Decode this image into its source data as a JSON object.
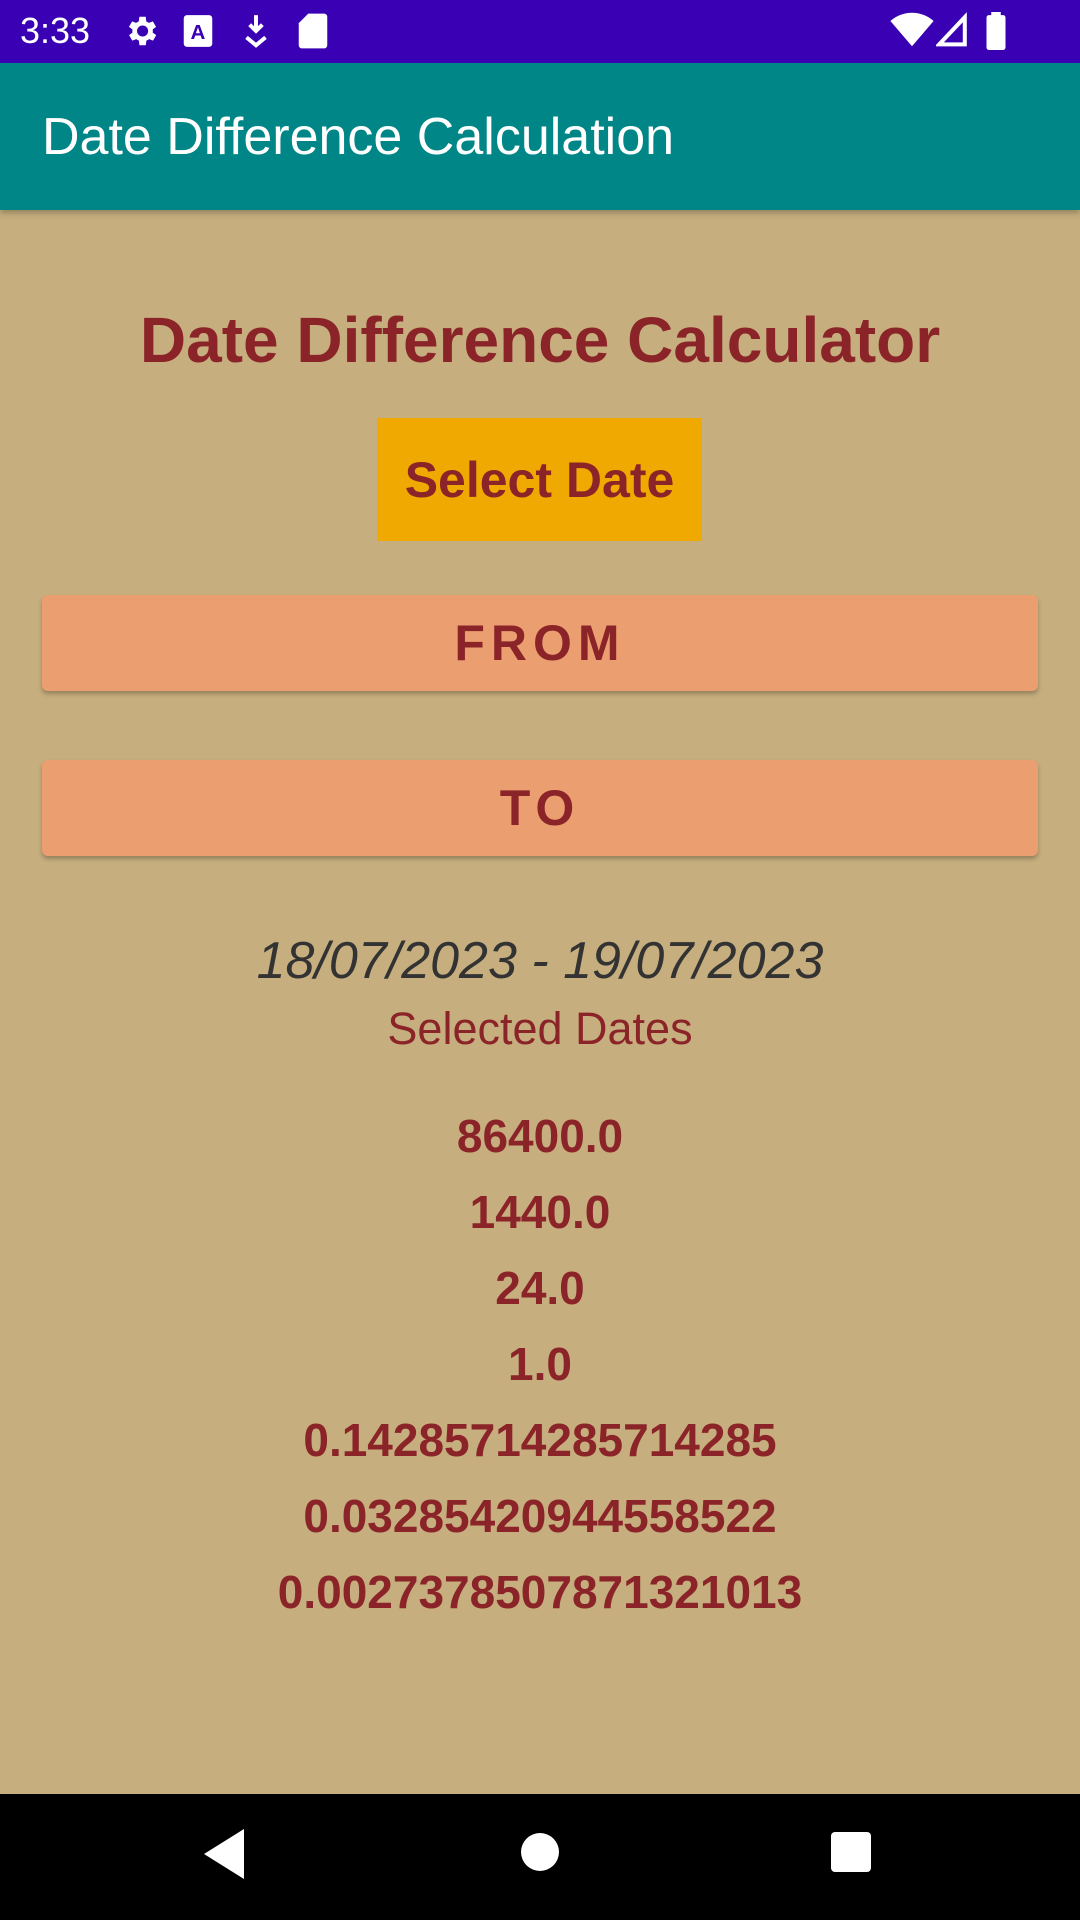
{
  "status_bar": {
    "time": "3:33",
    "icons": [
      "settings-icon",
      "text-input-icon",
      "download-icon",
      "sd-card-icon",
      "wifi-icon",
      "signal-icon",
      "battery-icon"
    ]
  },
  "app_bar": {
    "title": "Date Difference Calculation"
  },
  "main": {
    "heading": "Date Difference Calculator",
    "select_date_label": "Select Date",
    "from_label": "FROM",
    "to_label": "TO",
    "date_range": "18/07/2023 - 19/07/2023",
    "selected_label": "Selected Dates",
    "results": [
      "86400.0",
      "1440.0",
      "24.0",
      "1.0",
      "0.14285714285714285",
      "0.03285420944558522",
      "0.0027378507871321013"
    ]
  },
  "nav_bar": {
    "icons": [
      "back-icon",
      "home-icon",
      "recents-icon"
    ]
  },
  "colors": {
    "status_bar": "#3a00b4",
    "app_bar": "#008686",
    "background": "#c6ae7e",
    "accent_text": "#8b2428",
    "select_button": "#f0a900",
    "range_buttons": "#eb9f70"
  }
}
